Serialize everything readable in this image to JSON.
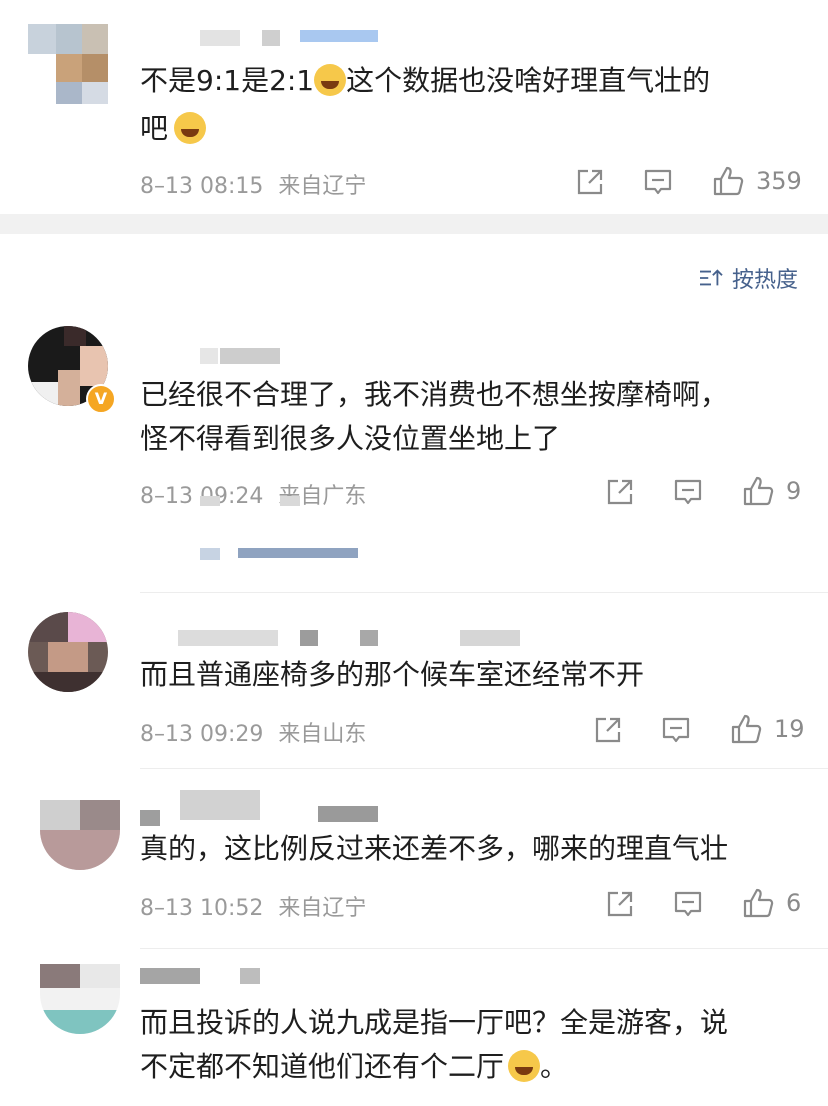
{
  "comments": [
    {
      "text_line1": "不是9:1是2:1",
      "emoji1": "laugh-cry-emoji",
      "text_line1b": "这个数据也没啥好理直气壮的",
      "text_line2": "吧",
      "emoji2": "dizzy-emoji",
      "date": "8–13 08:15",
      "location": "来自辽宁",
      "likes": "359"
    },
    {
      "text_line1": "已经很不合理了，我不消费也不想坐按摩椅啊，",
      "text_line2": "怪不得看到很多人没位置坐地上了",
      "date": "8–13 09:24",
      "location": "来自广东",
      "likes": "9",
      "verified": "V"
    },
    {
      "text_line1": "而且普通座椅多的那个候车室还经常不开",
      "date": "8–13 09:29",
      "location": "来自山东",
      "likes": "19"
    },
    {
      "text_line1": "真的，这比例反过来还差不多，哪来的理直气壮",
      "date": "8–13 10:52",
      "location": "来自辽宁",
      "likes": "6"
    },
    {
      "text_line1": "而且投诉的人说九成是指一厅吧？全是游客，说",
      "text_line2": "不定都不知道他们还有个二厅",
      "emoji": "crying-emoji",
      "text_tail": "。"
    }
  ],
  "sort": {
    "label": "按热度",
    "icon": "sort-icon"
  },
  "colors": {
    "link": "#46618c",
    "meta": "#9a9a9a",
    "band": "#f1f1f1",
    "verified": "#f5a623"
  }
}
